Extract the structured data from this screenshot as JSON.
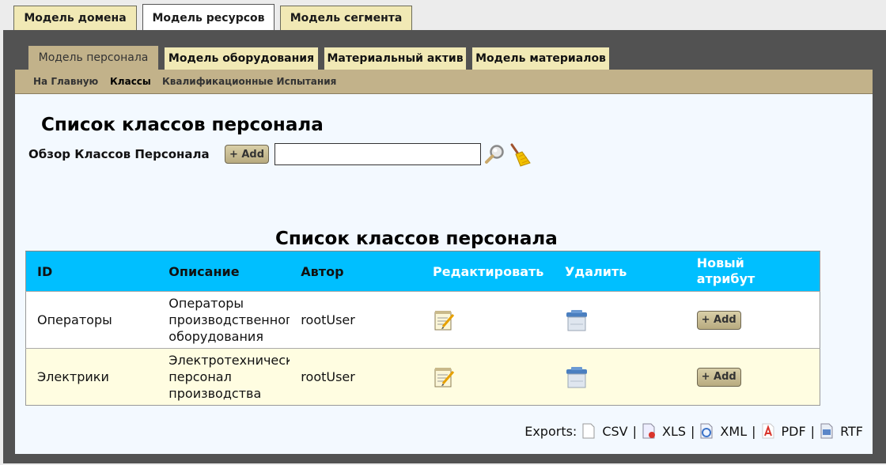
{
  "top_tabs": [
    "Модель домена",
    "Модель ресурсов",
    "Модель сегмента"
  ],
  "sub_tabs": [
    "Модель персонала",
    "Модель оборудования",
    "Материальный актив",
    "Модель материалов"
  ],
  "subnav": [
    "На Главную",
    "Классы",
    "Квалификационные Испытания"
  ],
  "page_title": "Список классов персонала",
  "browse_label": "Обзор Классов Персонала",
  "add_label": "+ Add",
  "search": {
    "value": "",
    "placeholder": ""
  },
  "table": {
    "title": "Список классов персонала",
    "headers": [
      "ID",
      "Описание",
      "Автор",
      "Редактировать",
      "Удалить",
      "Новый атрибут"
    ],
    "rows": [
      {
        "id": "Операторы",
        "desc": [
          "Операторы",
          "производственного",
          "оборудования"
        ],
        "author": "rootUser"
      },
      {
        "id": "Электрики",
        "desc": [
          "Электротехнический",
          "персонал",
          "производства"
        ],
        "author": "rootUser"
      }
    ]
  },
  "exports": {
    "label": "Exports:",
    "items": [
      "CSV",
      "XLS",
      "XML",
      "PDF",
      "RTF"
    ],
    "sep": "|"
  },
  "colors": {
    "header_blue": "#00bfff",
    "tab_cream": "#f1e9b5",
    "tan_bar": "#c2b28a",
    "frame": "#525252",
    "row_alt": "#fffde1"
  },
  "icons": [
    "search-icon",
    "broom-icon",
    "edit-notepad-icon",
    "trash-icon",
    "csv-file-icon",
    "xls-file-icon",
    "xml-file-icon",
    "pdf-file-icon",
    "rtf-file-icon"
  ]
}
